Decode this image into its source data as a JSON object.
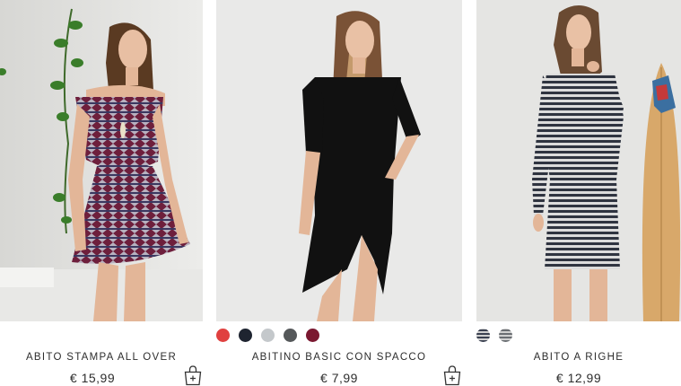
{
  "products": [
    {
      "name": "ABITO STAMPA ALL OVER",
      "price": "€ 15,99",
      "image_alt": "woman in off-shoulder printed dress",
      "has_cart_button": true,
      "swatches": []
    },
    {
      "name": "ABITINO BASIC CON SPACCO",
      "price": "€ 7,99",
      "image_alt": "woman in black midi dress with slit",
      "has_cart_button": true,
      "swatches": [
        {
          "name": "red",
          "color": "#e0403f"
        },
        {
          "name": "navy",
          "color": "#1e2430"
        },
        {
          "name": "light-grey",
          "color": "#c4c8cb"
        },
        {
          "name": "dark-grey",
          "color": "#55585a"
        },
        {
          "name": "burgundy",
          "color": "#7a1830"
        }
      ]
    },
    {
      "name": "ABITO A RIGHE",
      "price": "€ 12,99",
      "image_alt": "woman in striped long sleeve dress",
      "has_cart_button": false,
      "swatches": [
        {
          "name": "stripe-navy",
          "color": "#3a4050"
        },
        {
          "name": "stripe-grey",
          "color": "#6a6e72"
        }
      ]
    }
  ],
  "icons": {
    "cart": "shopping-bag-plus-icon"
  }
}
